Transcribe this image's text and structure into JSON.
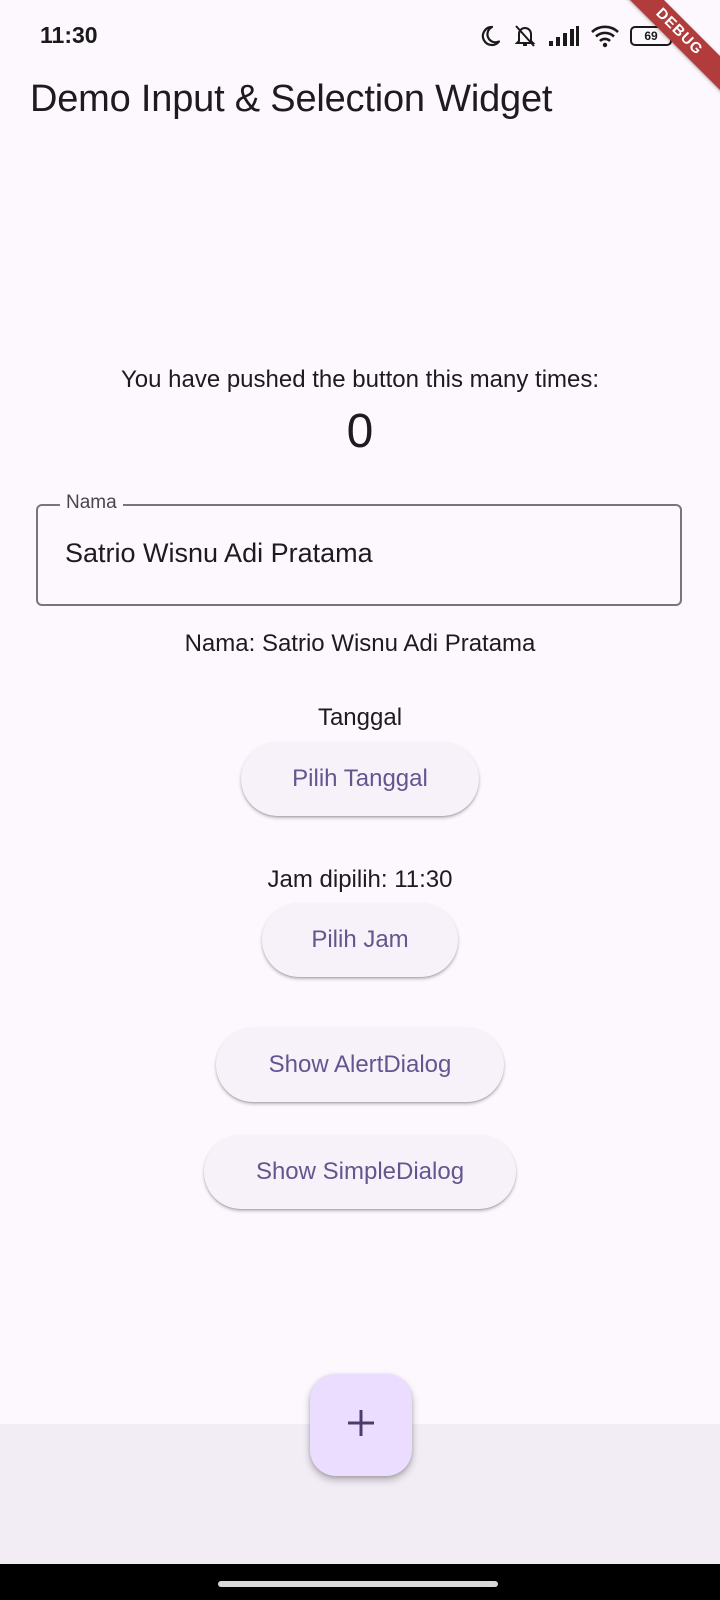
{
  "status_bar": {
    "time": "11:30",
    "battery": "69",
    "icons": [
      "moon-icon",
      "bell-off-icon",
      "signal-icon",
      "wifi-icon",
      "battery-icon"
    ]
  },
  "debug_banner": "DEBUG",
  "app_bar": {
    "title": "Demo Input & Selection Widget"
  },
  "counter": {
    "label": "You have pushed the button this many times:",
    "value": "0"
  },
  "name_field": {
    "label": "Nama",
    "value": "Satrio Wisnu Adi Pratama"
  },
  "name_display": "Nama: Satrio Wisnu Adi Pratama",
  "date_section": {
    "label": "Tanggal",
    "button": "Pilih Tanggal"
  },
  "time_section": {
    "label": "Jam dipilih: 11:30",
    "button": "Pilih Jam"
  },
  "dialog_buttons": {
    "alert": "Show AlertDialog",
    "simple": "Show SimpleDialog"
  },
  "fab": {
    "icon": "plus-icon"
  },
  "colors": {
    "background": "#fdf7fe",
    "button_text": "#65558f",
    "button_bg": "#f7f2fa",
    "fab_bg": "#eaddff",
    "bottom_area": "#f2ecf4",
    "debug_ribbon": "#b23b3b"
  }
}
